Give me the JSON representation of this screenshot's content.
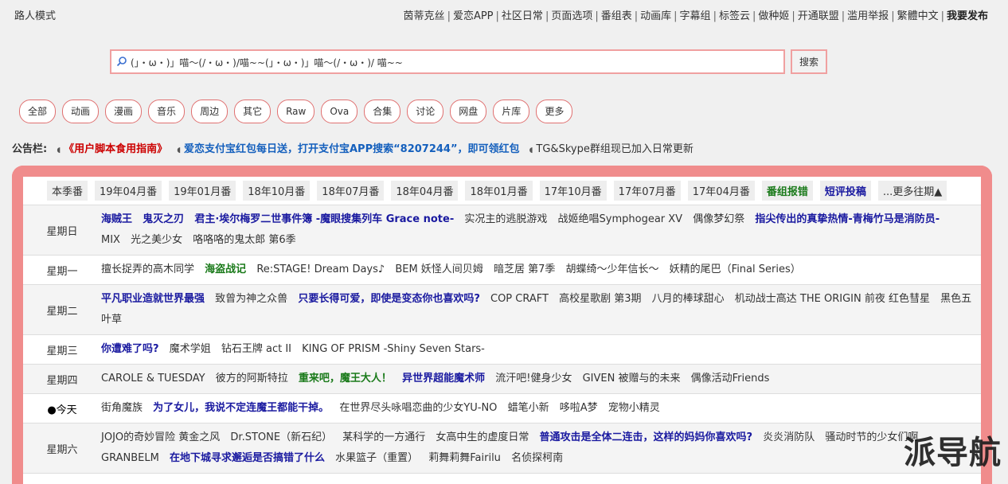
{
  "header": {
    "guest_mode": "路人模式",
    "nav": [
      {
        "label": "茵蒂克丝"
      },
      {
        "label": "爱恋APP"
      },
      {
        "label": "社区日常"
      },
      {
        "label": "页面选项"
      },
      {
        "label": "番组表"
      },
      {
        "label": "动画库"
      },
      {
        "label": "字幕组"
      },
      {
        "label": "标签云"
      },
      {
        "label": "做种姬"
      },
      {
        "label": "开通联盟"
      },
      {
        "label": "滥用举报"
      },
      {
        "label": "繁體中文"
      },
      {
        "label": "我要发布"
      }
    ]
  },
  "search": {
    "value": "(」・ω・)」喵～(/・ω・)/喵~~(」・ω・)」喵～(/・ω・)/ 喵~~",
    "button": "搜索"
  },
  "categories": [
    "全部",
    "动画",
    "漫画",
    "音乐",
    "周边",
    "其它",
    "Raw",
    "Ova",
    "合集",
    "讨论",
    "网盘",
    "片库",
    "更多"
  ],
  "notice": {
    "label": "公告栏:",
    "items": [
      "《用户脚本食用指南》",
      "爱恋支付宝红包每日送，打开支付宝APP搜索“8207244”，即可领红包",
      "TG&Skype群组现已加入日常更新"
    ]
  },
  "seasons": [
    {
      "label": "本季番",
      "style": ""
    },
    {
      "label": "19年04月番",
      "style": ""
    },
    {
      "label": "19年01月番",
      "style": ""
    },
    {
      "label": "18年10月番",
      "style": ""
    },
    {
      "label": "18年07月番",
      "style": ""
    },
    {
      "label": "18年04月番",
      "style": ""
    },
    {
      "label": "18年01月番",
      "style": ""
    },
    {
      "label": "17年10月番",
      "style": ""
    },
    {
      "label": "17年07月番",
      "style": ""
    },
    {
      "label": "17年04月番",
      "style": ""
    },
    {
      "label": "番组报错",
      "style": "green"
    },
    {
      "label": "短评投稿",
      "style": "blue"
    },
    {
      "label": "...更多往期▲",
      "style": ""
    }
  ],
  "schedule": [
    {
      "day": "星期日",
      "today": false,
      "shows": [
        {
          "t": "海贼王",
          "s": "b"
        },
        {
          "t": "鬼灭之刃",
          "s": "b"
        },
        {
          "t": "君主·埃尔梅罗二世事件簿 -魔眼搜集列车 Grace note-",
          "s": "b"
        },
        {
          "t": "实况主的逃脱游戏",
          "s": ""
        },
        {
          "t": "战姬绝唱Symphogear XV",
          "s": ""
        },
        {
          "t": "偶像梦幻祭",
          "s": ""
        },
        {
          "t": "指尖传出的真挚热情-青梅竹马是消防员-",
          "s": "b"
        },
        {
          "t": "MIX",
          "s": ""
        },
        {
          "t": "光之美少女",
          "s": ""
        },
        {
          "t": "咯咯咯的鬼太郎 第6季",
          "s": ""
        }
      ]
    },
    {
      "day": "星期一",
      "today": false,
      "shows": [
        {
          "t": "擅长捉弄的高木同学",
          "s": ""
        },
        {
          "t": "海盗战记",
          "s": "g"
        },
        {
          "t": "Re:STAGE! Dream Days♪",
          "s": ""
        },
        {
          "t": "BEM 妖怪人间贝姆",
          "s": ""
        },
        {
          "t": "暗芝居 第7季",
          "s": ""
        },
        {
          "t": "胡蝶绮～少年信长～",
          "s": ""
        },
        {
          "t": "妖精的尾巴（Final Series）",
          "s": ""
        }
      ]
    },
    {
      "day": "星期二",
      "today": false,
      "shows": [
        {
          "t": "平凡职业造就世界最强",
          "s": "b"
        },
        {
          "t": "致曾为神之众兽",
          "s": ""
        },
        {
          "t": "只要长得可爱，即使是变态你也喜欢吗?",
          "s": "b"
        },
        {
          "t": "COP CRAFT",
          "s": ""
        },
        {
          "t": "高校星歌剧 第3期",
          "s": ""
        },
        {
          "t": "八月的棒球甜心",
          "s": ""
        },
        {
          "t": "机动战士高达 THE ORIGIN 前夜 红色彗星",
          "s": ""
        },
        {
          "t": "黑色五叶草",
          "s": ""
        }
      ]
    },
    {
      "day": "星期三",
      "today": false,
      "shows": [
        {
          "t": "你遭难了吗?",
          "s": "b"
        },
        {
          "t": "魔术学姐",
          "s": ""
        },
        {
          "t": "钻石王牌 act II",
          "s": ""
        },
        {
          "t": "KING OF PRISM -Shiny Seven Stars-",
          "s": ""
        }
      ]
    },
    {
      "day": "星期四",
      "today": false,
      "shows": [
        {
          "t": "CAROLE & TUESDAY",
          "s": ""
        },
        {
          "t": "彼方的阿斯特拉",
          "s": ""
        },
        {
          "t": "重来吧，魔王大人！",
          "s": "g"
        },
        {
          "t": "异世界超能魔术师",
          "s": "b"
        },
        {
          "t": "流汗吧!健身少女",
          "s": ""
        },
        {
          "t": "GIVEN 被赠与的未来",
          "s": ""
        },
        {
          "t": "偶像活动Friends",
          "s": ""
        }
      ]
    },
    {
      "day": "●今天",
      "today": true,
      "shows": [
        {
          "t": "街角魔族",
          "s": ""
        },
        {
          "t": "为了女儿，我说不定连魔王都能干掉。",
          "s": "b"
        },
        {
          "t": "在世界尽头咏唱恋曲的少女YU-NO",
          "s": ""
        },
        {
          "t": "蜡笔小新",
          "s": ""
        },
        {
          "t": "哆啦A梦",
          "s": ""
        },
        {
          "t": "宠物小精灵",
          "s": ""
        }
      ]
    },
    {
      "day": "星期六",
      "today": false,
      "shows": [
        {
          "t": "JOJO的奇妙冒险 黄金之风",
          "s": ""
        },
        {
          "t": "Dr.STONE（新石纪）",
          "s": ""
        },
        {
          "t": "某科学的一方通行",
          "s": ""
        },
        {
          "t": "女高中生的虚度日常",
          "s": ""
        },
        {
          "t": "普通攻击是全体二连击，这样的妈妈你喜欢吗?",
          "s": "b"
        },
        {
          "t": "炎炎消防队",
          "s": ""
        },
        {
          "t": "骚动时节的少女们啊",
          "s": ""
        },
        {
          "t": "GRANBELM",
          "s": ""
        },
        {
          "t": "在地下城寻求邂逅是否搞错了什么",
          "s": "b"
        },
        {
          "t": "水果篮子（重置）",
          "s": ""
        },
        {
          "t": "莉舞莉舞Fairilu",
          "s": ""
        },
        {
          "t": "名侦探柯南",
          "s": ""
        }
      ]
    }
  ],
  "watermark": "派导航"
}
